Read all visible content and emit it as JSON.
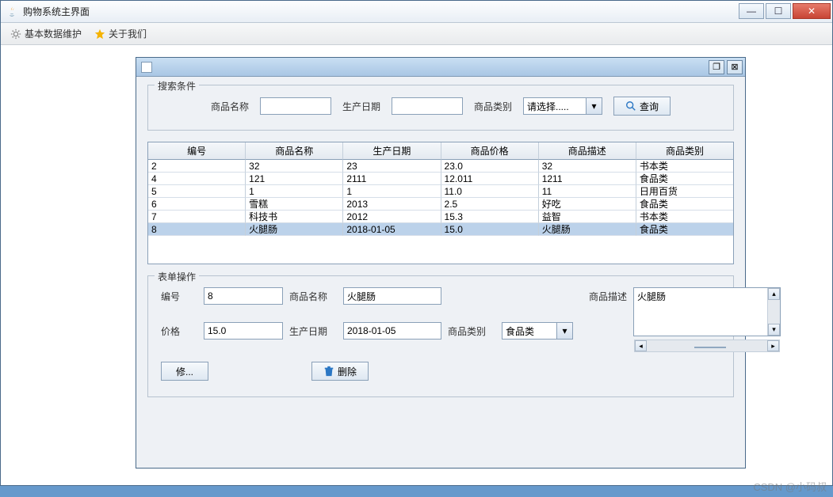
{
  "window": {
    "title": "购物系统主界面"
  },
  "menubar": {
    "basic_data": "基本数据维护",
    "about_us": "关于我们"
  },
  "search_group": {
    "legend": "搜索条件",
    "product_name_label": "商品名称",
    "product_name_value": "",
    "production_date_label": "生产日期",
    "production_date_value": "",
    "category_label": "商品类别",
    "category_selected": "请选择.....",
    "query_btn": "查询"
  },
  "table": {
    "columns": [
      "编号",
      "商品名称",
      "生产日期",
      "商品价格",
      "商品描述",
      "商品类别"
    ],
    "rows": [
      {
        "c": [
          "2",
          "32",
          "23",
          "23.0",
          "32",
          "书本类"
        ],
        "sel": false
      },
      {
        "c": [
          "4",
          "121",
          "2111",
          "12.011",
          "1211",
          "食品类"
        ],
        "sel": false
      },
      {
        "c": [
          "5",
          "1",
          "1",
          "11.0",
          "11",
          "日用百货"
        ],
        "sel": false
      },
      {
        "c": [
          "6",
          "雪糕",
          "2013",
          "2.5",
          "好吃",
          "食品类"
        ],
        "sel": false
      },
      {
        "c": [
          "7",
          "科技书",
          "2012",
          "15.3",
          "益智",
          "书本类"
        ],
        "sel": false
      },
      {
        "c": [
          "8",
          "火腿肠",
          "2018-01-05",
          "15.0",
          "火腿肠",
          "食品类"
        ],
        "sel": true
      }
    ]
  },
  "form_group": {
    "legend": "表单操作",
    "id_label": "编号",
    "id_value": "8",
    "name_label": "商品名称",
    "name_value": "火腿肠",
    "desc_label": "商品描述",
    "desc_value": "火腿肠",
    "price_label": "价格",
    "price_value": "15.0",
    "date_label": "生产日期",
    "date_value": "2018-01-05",
    "cat_label": "商品类别",
    "cat_value": "食品类",
    "edit_btn": "修...",
    "delete_btn": "删除"
  },
  "watermark": "CSDN @小码叔"
}
